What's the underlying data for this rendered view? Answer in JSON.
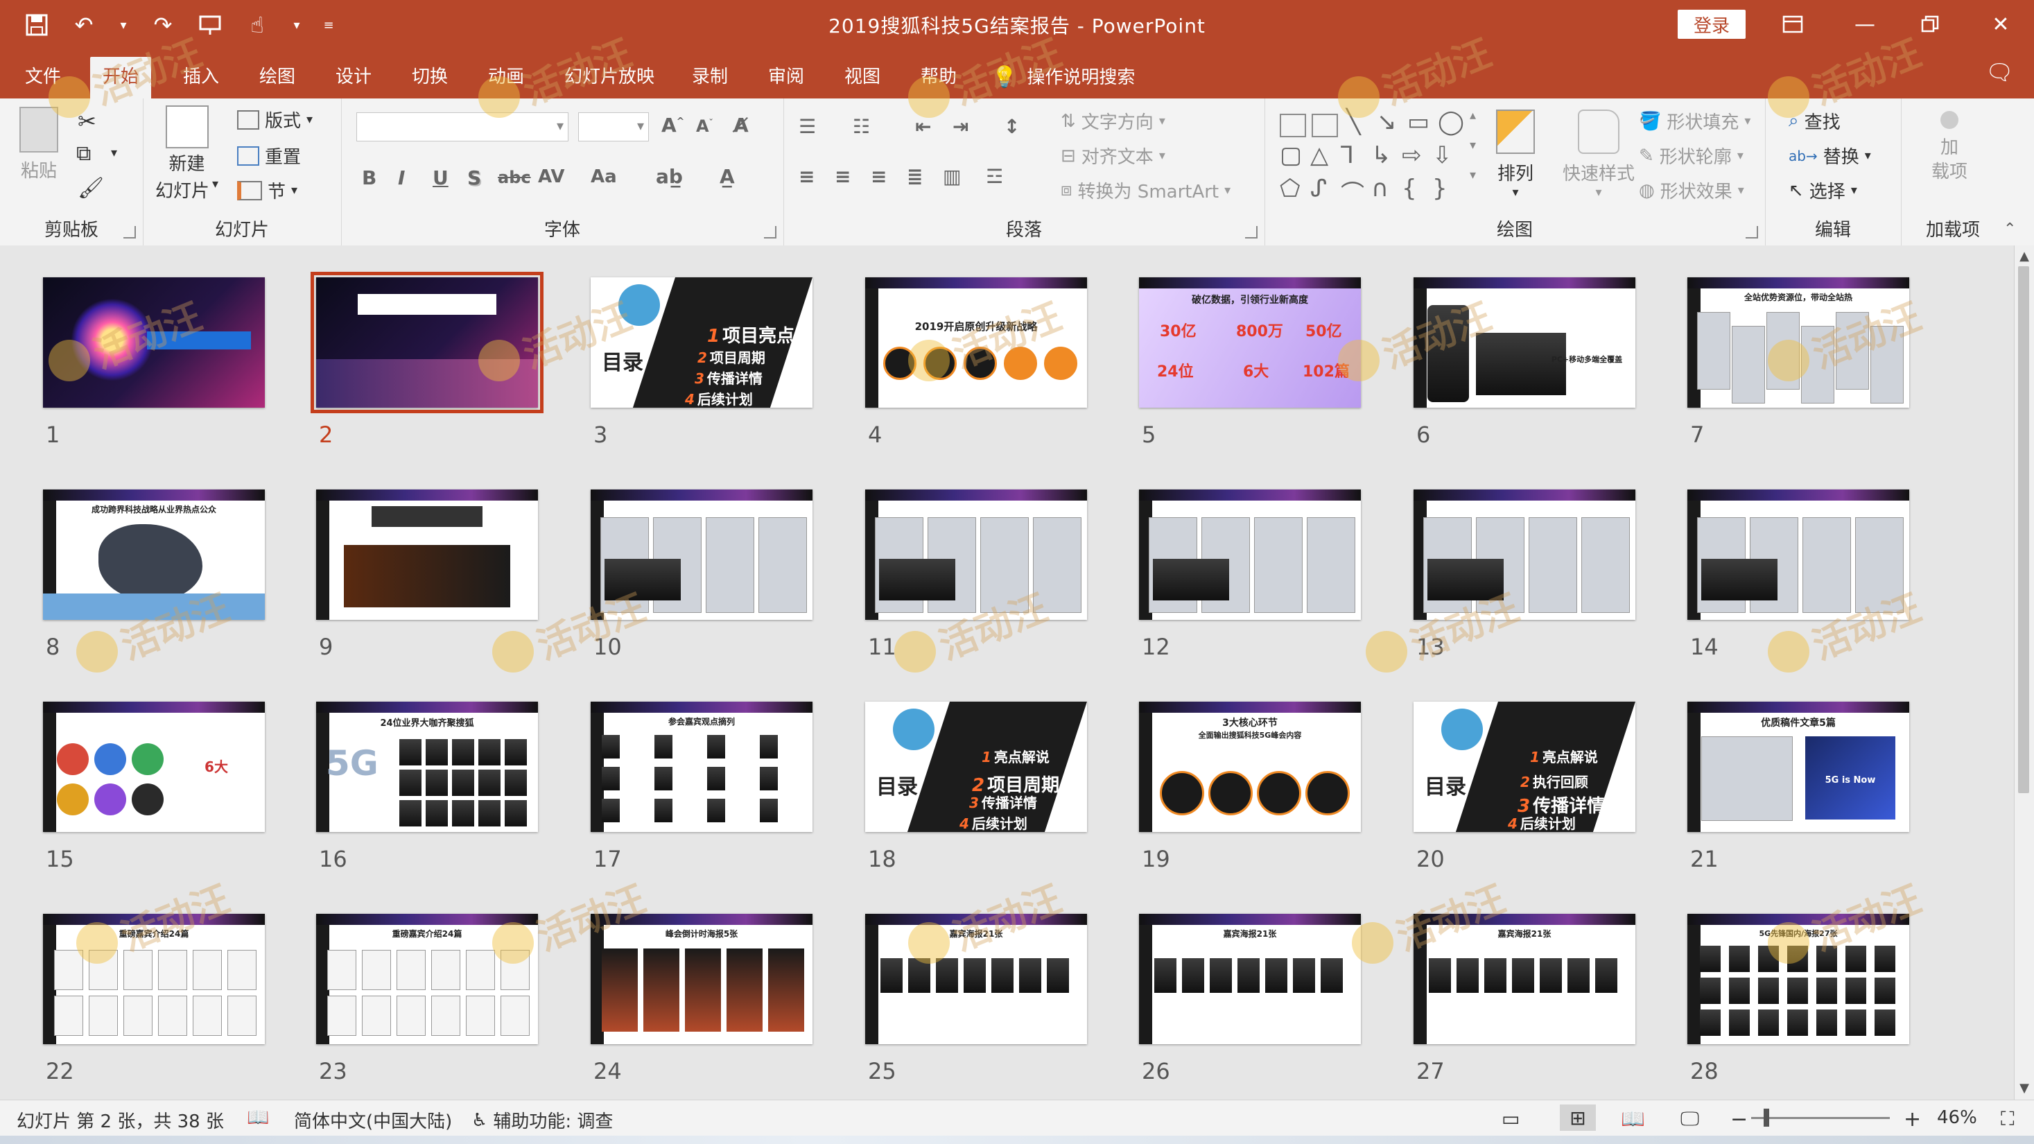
{
  "window": {
    "title": "2019搜狐科技5G结案报告 - PowerPoint",
    "login_label": "登录"
  },
  "quick_access": {
    "icons": [
      "save-icon",
      "undo-icon",
      "redo-icon",
      "present-icon",
      "touch-mode-icon",
      "customize-icon"
    ]
  },
  "tabs": [
    "文件",
    "开始",
    "插入",
    "绘图",
    "设计",
    "切换",
    "动画",
    "幻灯片放映",
    "录制",
    "审阅",
    "视图",
    "帮助"
  ],
  "active_tab": "开始",
  "tell_me": "操作说明搜索",
  "ribbon": {
    "clipboard": {
      "label": "剪贴板",
      "paste": "粘贴"
    },
    "slides": {
      "label": "幻灯片",
      "new_slide_1": "新建",
      "new_slide_2": "幻灯片",
      "layout": "版式",
      "reset": "重置",
      "section": "节"
    },
    "font": {
      "label": "字体",
      "bold": "B",
      "italic": "I",
      "underline": "U",
      "shadow": "S",
      "strike": "abc",
      "spacing": "AV",
      "case": "Aa"
    },
    "paragraph": {
      "label": "段落",
      "text_direction": "文字方向",
      "align_text": "对齐文本",
      "smartart": "转换为 SmartArt"
    },
    "drawing": {
      "label": "绘图",
      "arrange": "排列",
      "quick_styles": "快速样式",
      "shape_fill": "形状填充",
      "shape_outline": "形状轮廓",
      "shape_effects": "形状效果"
    },
    "editing": {
      "label": "编辑",
      "find": "查找",
      "replace": "替换",
      "select": "选择"
    },
    "addins": {
      "label": "加载项",
      "addins_1": "加",
      "addins_2": "载项"
    }
  },
  "slides": [
    {
      "num": "1",
      "style": "dark"
    },
    {
      "num": "2",
      "style": "dark",
      "selected": true
    },
    {
      "num": "3",
      "style": "toc"
    },
    {
      "num": "4",
      "style": "tech"
    },
    {
      "num": "5",
      "style": "purple"
    },
    {
      "num": "6",
      "style": "tech"
    },
    {
      "num": "7",
      "style": "tech"
    },
    {
      "num": "8",
      "style": "tech"
    },
    {
      "num": "9",
      "style": "tech"
    },
    {
      "num": "10",
      "style": "tech"
    },
    {
      "num": "11",
      "style": "tech"
    },
    {
      "num": "12",
      "style": "tech"
    },
    {
      "num": "13",
      "style": "tech"
    },
    {
      "num": "14",
      "style": "tech"
    },
    {
      "num": "15",
      "style": "tech"
    },
    {
      "num": "16",
      "style": "tech"
    },
    {
      "num": "17",
      "style": "tech"
    },
    {
      "num": "18",
      "style": "toc"
    },
    {
      "num": "19",
      "style": "tech"
    },
    {
      "num": "20",
      "style": "toc"
    },
    {
      "num": "21",
      "style": "tech"
    },
    {
      "num": "22",
      "style": "tech"
    },
    {
      "num": "23",
      "style": "tech"
    },
    {
      "num": "24",
      "style": "tech"
    },
    {
      "num": "25",
      "style": "tech"
    },
    {
      "num": "26",
      "style": "tech"
    },
    {
      "num": "27",
      "style": "tech"
    },
    {
      "num": "28",
      "style": "tech"
    }
  ],
  "slide_text": {
    "s3_head": "目录",
    "s3_items": [
      "项目亮点",
      "项目周期",
      "传播详情",
      "后续计划"
    ],
    "s4_title": "2019开启原创升级新战略",
    "s5_title": "破亿数据，引领行业新高度",
    "s5_stats": [
      "30亿",
      "800万",
      "50亿",
      "24位",
      "6大",
      "102篇"
    ],
    "s6_caption": "PC+移动多端全覆盖",
    "s7_title": "全站优势资源位，带动全站热",
    "s8_title": "成功跨界科技战略从业界热点公众",
    "s16_title": "24位业界大咖齐聚搜狐",
    "s16_big": "5G",
    "s17_title": "参会嘉宾观点摘列",
    "s18_head": "目录",
    "s18_items": [
      "亮点解说",
      "项目周期",
      "传播详情",
      "后续计划"
    ],
    "s19_title": "3大核心环节",
    "s19_subtitle": "全面输出搜狐科技5G峰会内容",
    "s20_head": "目录",
    "s20_items": [
      "亮点解说",
      "执行回顾",
      "传播详情",
      "后续计划"
    ],
    "s21_title": "优质稿件文章5篇",
    "s21_screen": "5G is Now",
    "s22_title": "重磅嘉宾介绍24篇",
    "s23_title": "重磅嘉宾介绍24篇",
    "s24_title": "峰会倒计时海报5张",
    "s25_title": "嘉宾海报21张",
    "s26_title": "嘉宾海报21张",
    "s27_title": "嘉宾海报21张",
    "s28_title": "5G先锋国内/海报27张",
    "s15_tag": "6大"
  },
  "watermark": "活动汪",
  "statusbar": {
    "slide_info": "幻灯片 第 2 张，共 38 张",
    "language": "简体中文(中国大陆)",
    "accessibility": "辅助功能: 调查",
    "zoom": "46%",
    "zoom_level_percent": 46
  },
  "colors": {
    "accent": "#b7472a",
    "selection": "#c43e1c"
  }
}
